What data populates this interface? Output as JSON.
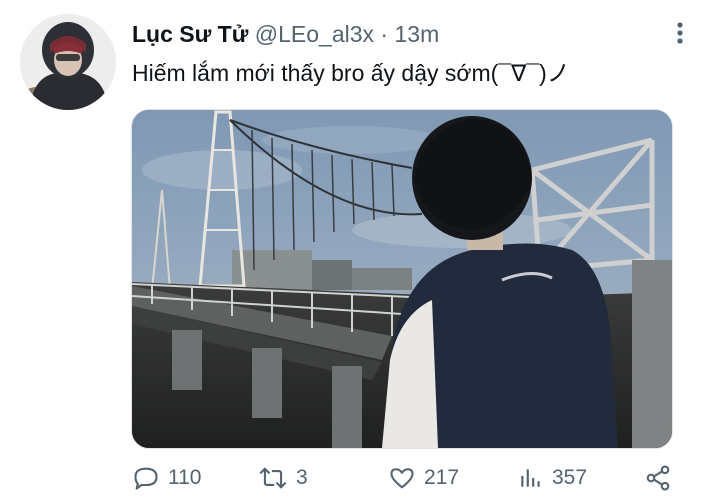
{
  "tweet": {
    "author_name": "Lục Sư Tử",
    "handle": "@LEo_al3x",
    "separator": "·",
    "time": "13m",
    "text": "Hiếm lắm mới thấy bro ấy dậy sớm(¯∇¯)ノ"
  },
  "actions": {
    "replies": "110",
    "retweets": "3",
    "likes": "217",
    "views": "357"
  },
  "icons": {
    "more": "more-vertical-icon",
    "reply": "reply-icon",
    "retweet": "retweet-icon",
    "like": "heart-icon",
    "views": "views-chart-icon",
    "share": "share-icon"
  },
  "colors": {
    "text": "#0f1419",
    "secondary": "#536471"
  }
}
